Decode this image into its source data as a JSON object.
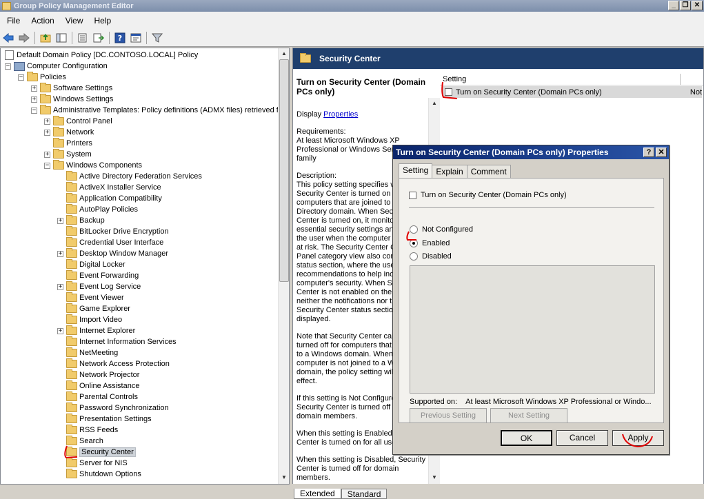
{
  "window": {
    "title": "Group Policy Management Editor"
  },
  "menu": [
    "File",
    "Action",
    "View",
    "Help"
  ],
  "toolbar_icons": [
    "back-arrow-icon",
    "forward-arrow-icon",
    "up-folder-icon",
    "show-hide-tree-icon",
    "export-list-icon",
    "export-icon",
    "help-icon",
    "properties-icon",
    "filter-icon"
  ],
  "tree": [
    {
      "label": "Default Domain Policy [DC.CONTOSO.LOCAL] Policy",
      "level": 0,
      "expander": "none",
      "icon": "policy"
    },
    {
      "label": "Computer Configuration",
      "level": 0,
      "expander": "minus",
      "icon": "computer"
    },
    {
      "label": "Policies",
      "level": 1,
      "expander": "minus",
      "icon": "folder"
    },
    {
      "label": "Software Settings",
      "level": 2,
      "expander": "plus",
      "icon": "folder"
    },
    {
      "label": "Windows Settings",
      "level": 2,
      "expander": "plus",
      "icon": "folder"
    },
    {
      "label": "Administrative Templates: Policy definitions (ADMX files) retrieved f",
      "level": 2,
      "expander": "minus",
      "icon": "folder"
    },
    {
      "label": "Control Panel",
      "level": 3,
      "expander": "plus",
      "icon": "folder"
    },
    {
      "label": "Network",
      "level": 3,
      "expander": "plus",
      "icon": "folder"
    },
    {
      "label": "Printers",
      "level": 3,
      "expander": "none",
      "icon": "folder"
    },
    {
      "label": "System",
      "level": 3,
      "expander": "plus",
      "icon": "folder"
    },
    {
      "label": "Windows Components",
      "level": 3,
      "expander": "minus",
      "icon": "folder"
    },
    {
      "label": "Active Directory Federation Services",
      "level": 4,
      "expander": "none",
      "icon": "folder"
    },
    {
      "label": "ActiveX Installer Service",
      "level": 4,
      "expander": "none",
      "icon": "folder"
    },
    {
      "label": "Application Compatibility",
      "level": 4,
      "expander": "none",
      "icon": "folder"
    },
    {
      "label": "AutoPlay Policies",
      "level": 4,
      "expander": "none",
      "icon": "folder"
    },
    {
      "label": "Backup",
      "level": 4,
      "expander": "plus",
      "icon": "folder"
    },
    {
      "label": "BitLocker Drive Encryption",
      "level": 4,
      "expander": "none",
      "icon": "folder"
    },
    {
      "label": "Credential User Interface",
      "level": 4,
      "expander": "none",
      "icon": "folder"
    },
    {
      "label": "Desktop Window Manager",
      "level": 4,
      "expander": "plus",
      "icon": "folder"
    },
    {
      "label": "Digital Locker",
      "level": 4,
      "expander": "none",
      "icon": "folder"
    },
    {
      "label": "Event Forwarding",
      "level": 4,
      "expander": "none",
      "icon": "folder"
    },
    {
      "label": "Event Log Service",
      "level": 4,
      "expander": "plus",
      "icon": "folder"
    },
    {
      "label": "Event Viewer",
      "level": 4,
      "expander": "none",
      "icon": "folder"
    },
    {
      "label": "Game Explorer",
      "level": 4,
      "expander": "none",
      "icon": "folder"
    },
    {
      "label": "Import Video",
      "level": 4,
      "expander": "none",
      "icon": "folder"
    },
    {
      "label": "Internet Explorer",
      "level": 4,
      "expander": "plus",
      "icon": "folder"
    },
    {
      "label": "Internet Information Services",
      "level": 4,
      "expander": "none",
      "icon": "folder"
    },
    {
      "label": "NetMeeting",
      "level": 4,
      "expander": "none",
      "icon": "folder"
    },
    {
      "label": "Network Access Protection",
      "level": 4,
      "expander": "none",
      "icon": "folder"
    },
    {
      "label": "Network Projector",
      "level": 4,
      "expander": "none",
      "icon": "folder"
    },
    {
      "label": "Online Assistance",
      "level": 4,
      "expander": "none",
      "icon": "folder"
    },
    {
      "label": "Parental Controls",
      "level": 4,
      "expander": "none",
      "icon": "folder"
    },
    {
      "label": "Password Synchronization",
      "level": 4,
      "expander": "none",
      "icon": "folder"
    },
    {
      "label": "Presentation Settings",
      "level": 4,
      "expander": "none",
      "icon": "folder"
    },
    {
      "label": "RSS Feeds",
      "level": 4,
      "expander": "none",
      "icon": "folder"
    },
    {
      "label": "Search",
      "level": 4,
      "expander": "none",
      "icon": "folder"
    },
    {
      "label": "Security Center",
      "level": 4,
      "expander": "none",
      "icon": "folder",
      "selected": true
    },
    {
      "label": "Server for NIS",
      "level": 4,
      "expander": "none",
      "icon": "folder"
    },
    {
      "label": "Shutdown Options",
      "level": 4,
      "expander": "none",
      "icon": "folder"
    }
  ],
  "right_header": {
    "title": "Security Center"
  },
  "description": {
    "title": "Turn on Security Center (Domain PCs only)",
    "display_prefix": "Display ",
    "display_link": "Properties",
    "requirements": "Requirements:\nAt least Microsoft Windows XP Professional or Windows Server 2003 family",
    "desc1": "Description:\nThis policy setting specifies whether Security Center is turned on or off for computers that are joined to an Active Directory domain. When Security Center is turned on, it monitors essential security settings and notifies the user when the computer might be at risk. The Security Center Control Panel category view also contains a status section, where the user can get recommendations to help increase the computer's security. When Security Center is not enabled on the domain, neither the notifications nor the Security Center status section are displayed.",
    "desc2": "Note that Security Center can only be turned off for computers that are joined to a Windows domain. When a computer is not joined to a Windows domain, the policy setting will have no effect.",
    "desc3": "If this setting is Not Configured, the Security Center is turned off for domain members.",
    "desc4": "When this setting is Enabled, Security Center is turned on for all users.",
    "desc5": "When this setting is Disabled, Security Center is turned off for domain members."
  },
  "list": {
    "columns": [
      "Setting",
      ""
    ],
    "rows": [
      {
        "setting": "Turn on Security Center (Domain PCs only)",
        "state": "Not"
      }
    ]
  },
  "bottom_tabs": [
    {
      "label": "Extended",
      "active": true
    },
    {
      "label": "Standard",
      "active": false
    }
  ],
  "dialog": {
    "title": "Turn on Security Center (Domain PCs only) Properties",
    "help_btn": "?",
    "close_btn": "✕",
    "tabs": [
      {
        "label": "Setting",
        "active": true
      },
      {
        "label": "Explain",
        "active": false
      },
      {
        "label": "Comment",
        "active": false
      }
    ],
    "setting_name": "Turn on Security Center (Domain PCs only)",
    "options": [
      {
        "label": "Not Configured",
        "checked": false
      },
      {
        "label": "Enabled",
        "checked": true
      },
      {
        "label": "Disabled",
        "checked": false
      }
    ],
    "supported_label": "Supported on:",
    "supported_value": "At least Microsoft Windows XP Professional or Windo...",
    "prev_btn": "Previous Setting",
    "next_btn": "Next Setting",
    "ok_btn": "OK",
    "cancel_btn": "Cancel",
    "apply_btn": "Apply"
  },
  "colors": {
    "annotation_red": "#e00000",
    "header_blue": "#1f3f6d",
    "dialog_title": "#0a246a"
  }
}
